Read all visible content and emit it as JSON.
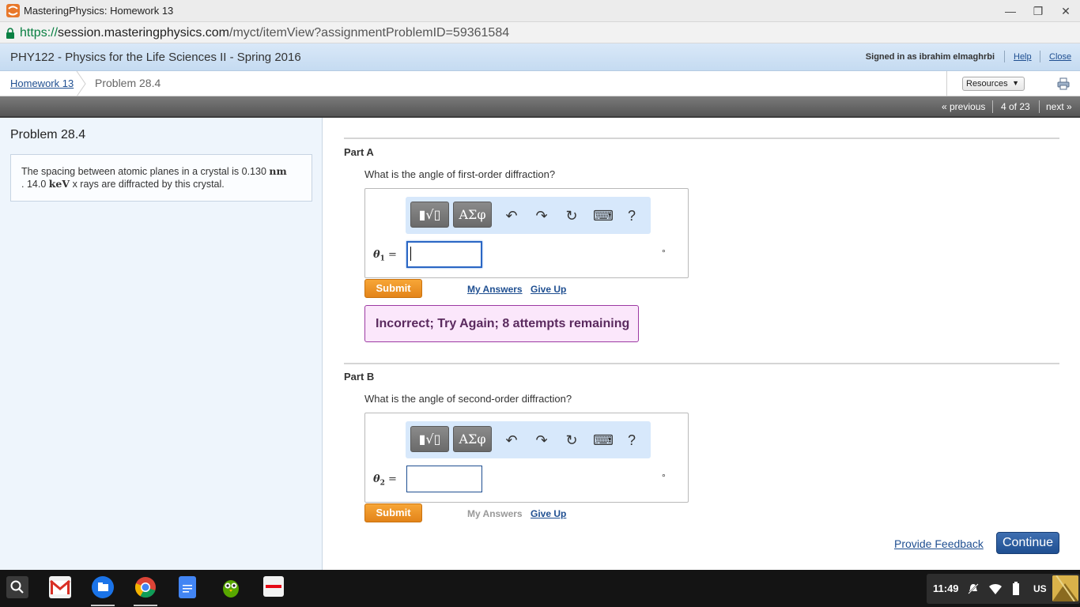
{
  "window": {
    "title": "MasteringPhysics: Homework 13",
    "minimize_glyph": "—",
    "restore_glyph": "❐",
    "close_glyph": "✕"
  },
  "url": {
    "scheme": "https://",
    "host": "session.masteringphysics.com",
    "path": "/myct/itemView?assignmentProblemID=59361584"
  },
  "header": {
    "course_title": "PHY122 - Physics for the Life Sciences II - Spring 2016",
    "signed_in": "Signed in as ibrahim elmaghrbi",
    "help_label": "Help",
    "close_label": "Close"
  },
  "breadcrumb": {
    "parent_label": "Homework 13",
    "current_label": "Problem 28.4",
    "resources_label": "Resources",
    "resources_caret": "▼"
  },
  "nav": {
    "previous_label": "« previous",
    "position_label": "4 of 23",
    "next_label": "next »"
  },
  "problem": {
    "title": "Problem 28.4",
    "text_1": "The spacing between atomic planes in a crystal is 0.130",
    "unit_1": "nm",
    "text_2": ". 14.0",
    "unit_2": "keV",
    "text_3": "x rays are diffracted by this crystal."
  },
  "toolbar": {
    "templates_label": "▮√▯",
    "greek_label": "ΑΣφ",
    "undo_glyph": "↶",
    "redo_glyph": "↷",
    "reset_glyph": "↻",
    "keyboard_glyph": "⌨",
    "help_glyph": "?"
  },
  "part_a": {
    "title": "Part A",
    "question": "What is the angle of first-order diffraction?",
    "variable": "θ",
    "subscript": "1",
    "equals": "=",
    "input_value": "",
    "unit": "°",
    "submit_label": "Submit",
    "my_answers_label": "My Answers",
    "give_up_label": "Give Up",
    "feedback": "Incorrect; Try Again; 8 attempts remaining"
  },
  "part_b": {
    "title": "Part B",
    "question": "What is the angle of second-order diffraction?",
    "variable": "θ",
    "subscript": "2",
    "equals": "=",
    "input_value": "",
    "unit": "°",
    "submit_label": "Submit",
    "my_answers_label": "My Answers",
    "give_up_label": "Give Up"
  },
  "footer": {
    "provide_feedback_label": "Provide Feedback",
    "continue_label": "Continue"
  },
  "shelf": {
    "apps": [
      "search-icon",
      "gmail-icon",
      "files-icon",
      "chrome-icon",
      "docs-icon",
      "duolingo-icon",
      "netflix-icon"
    ],
    "time": "11:49",
    "input_method": "US"
  }
}
